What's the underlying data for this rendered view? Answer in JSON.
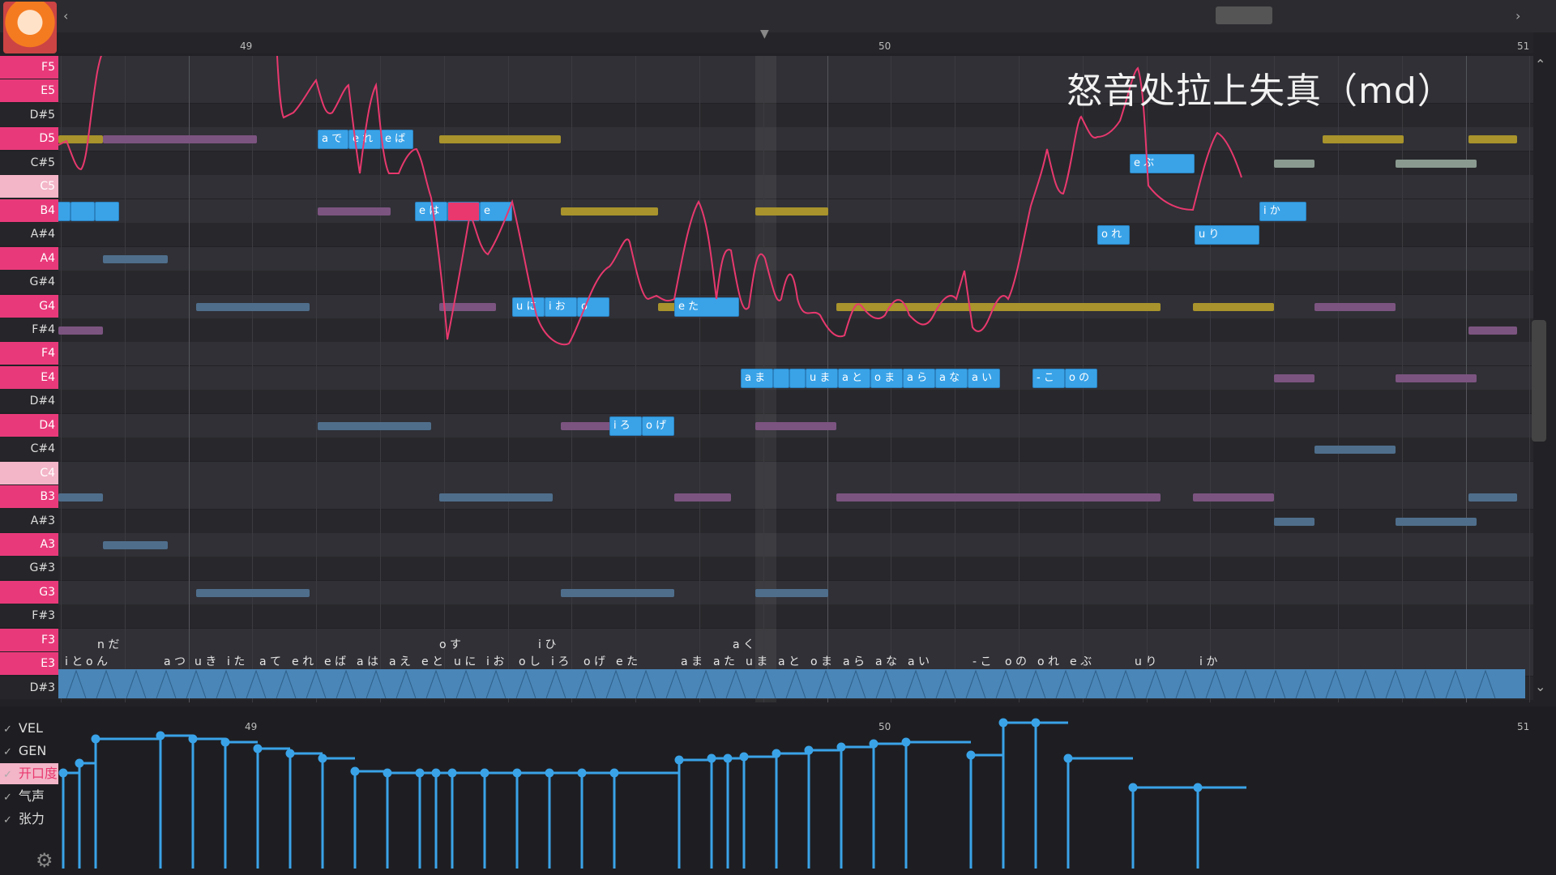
{
  "overlay_caption": "怒音处拉上失真（md）",
  "ruler": {
    "bars": [
      "49",
      "50",
      "51"
    ]
  },
  "keys": [
    "F5",
    "E5",
    "D#5",
    "D5",
    "C#5",
    "C5",
    "B4",
    "A#4",
    "A4",
    "G#4",
    "G4",
    "F#4",
    "F4",
    "E4",
    "D#4",
    "D4",
    "C#4",
    "C4",
    "B3",
    "A#3",
    "A3",
    "G#3",
    "G3",
    "F#3",
    "F3",
    "E3",
    "D#3"
  ],
  "params": {
    "vel": "VEL",
    "gen": "GEN",
    "opening": "开口度",
    "breath": "气声",
    "tension": "张力"
  },
  "param_ruler": {
    "bars": [
      "49",
      "50",
      "51"
    ]
  },
  "notes": [
    {
      "label": "a で"
    },
    {
      "label": "e れ"
    },
    {
      "label": "e ば"
    },
    {
      "label": "e は"
    },
    {
      "label": ""
    },
    {
      "label": "e"
    },
    {
      "label": "u に"
    },
    {
      "label": "i お"
    },
    {
      "label": "o"
    },
    {
      "label": "e た"
    },
    {
      "label": "i ろ"
    },
    {
      "label": "o げ"
    },
    {
      "label": "a ま"
    },
    {
      "label": ""
    },
    {
      "label": ""
    },
    {
      "label": "u ま"
    },
    {
      "label": "a と"
    },
    {
      "label": "o ま"
    },
    {
      "label": "a ら"
    },
    {
      "label": "a な"
    },
    {
      "label": "a い"
    },
    {
      "label": "- こ"
    },
    {
      "label": "o の"
    },
    {
      "label": "o れ"
    },
    {
      "label": "e ぶ"
    },
    {
      "label": "u り"
    },
    {
      "label": "i か"
    },
    {
      "label": ""
    },
    {
      "label": ""
    },
    {
      "label": ""
    }
  ],
  "phonemes_row1": [
    "n だ",
    "o す",
    "i ひ",
    "a く"
  ],
  "phonemes_row2": [
    "i と",
    "o ん",
    "a つ",
    "u き",
    "i た",
    "a て",
    "e れ",
    "e ば",
    "a は",
    "a え",
    "e と",
    "u に",
    "i お",
    "o し",
    "i ろ",
    "o げ",
    "e た",
    "a ま",
    "a た",
    "u ま",
    "a と",
    "o ま",
    "a ら",
    "a な",
    "a い",
    "- こ",
    "o の",
    "o れ",
    "e ぶ",
    "u り",
    "i か"
  ],
  "icons": {
    "settings": "gear-icon",
    "scroll_left": "chevron-left-icon",
    "scroll_right": "chevron-right-icon",
    "scroll_up": "chevron-up-icon",
    "scroll_down": "chevron-down-icon",
    "playhead": "playhead-marker-icon",
    "avatar": "singer-avatar"
  },
  "colors": {
    "note": "#3aa3e8",
    "selected_note": "#e8386e",
    "pitch_curve": "#e8386e",
    "white_key": "#e83a7a",
    "reference_gold": "#b8a22e",
    "reference_purple": "#8a5a8a",
    "reference_blue": "#5a7fa0"
  }
}
